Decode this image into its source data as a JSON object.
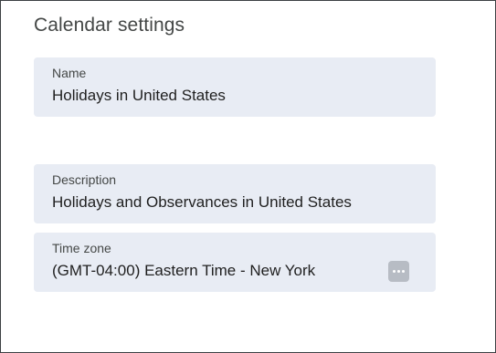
{
  "page": {
    "title": "Calendar settings"
  },
  "fields": {
    "name": {
      "label": "Name",
      "value": "Holidays in United States"
    },
    "description": {
      "label": "Description",
      "value": "Holidays and Observances in United States"
    },
    "time_zone": {
      "label": "Time zone",
      "value": "(GMT-04:00) Eastern Time - New York",
      "more_icon": "more-horizontal-icon"
    }
  },
  "colors": {
    "field_background": "#e8ecf4",
    "label": "#444746",
    "value": "#1f1f1f",
    "more_button": "#b7bcc4"
  }
}
